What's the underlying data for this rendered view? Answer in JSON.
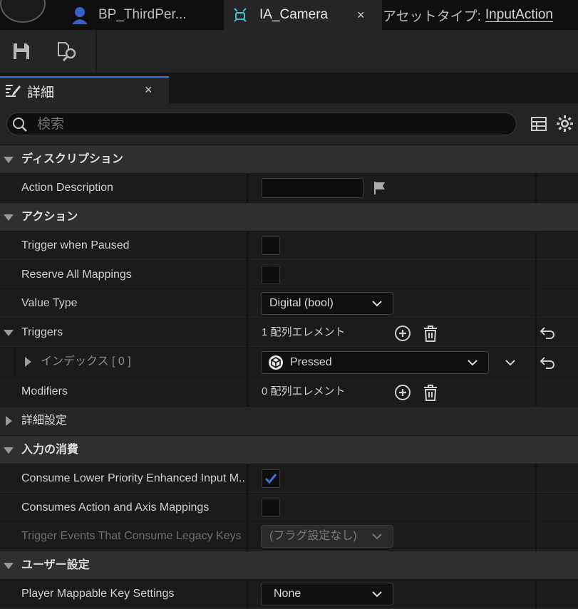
{
  "tabs": [
    {
      "label": "BP_ThirdPer...",
      "icon": "character-icon",
      "active": false
    },
    {
      "label": "IA_Camera",
      "icon": "input-action-icon",
      "active": true,
      "close": "×"
    }
  ],
  "asset_type": {
    "label": "アセットタイプ:",
    "value": "InputAction"
  },
  "toolbar": {
    "save": "save-icon",
    "browse": "browse-asset-icon"
  },
  "details_tab": {
    "label": "詳細",
    "close": "×"
  },
  "search": {
    "placeholder": "検索"
  },
  "sections": {
    "description": {
      "title": "ディスクリプション",
      "action_description": {
        "label": "Action Description",
        "value": ""
      }
    },
    "action": {
      "title": "アクション",
      "trigger_when_paused": {
        "label": "Trigger when Paused",
        "checked": false
      },
      "reserve_all_mappings": {
        "label": "Reserve All Mappings",
        "checked": false
      },
      "value_type": {
        "label": "Value Type",
        "value": "Digital (bool)"
      },
      "triggers": {
        "label": "Triggers",
        "count": "1 配列エレメント"
      },
      "index": {
        "label": "インデックス [ 0 ]",
        "value": "Pressed"
      },
      "modifiers": {
        "label": "Modifiers",
        "count": "0 配列エレメント"
      }
    },
    "advanced": {
      "title": "詳細設定"
    },
    "input_consumption": {
      "title": "入力の消費",
      "consume_lower": {
        "label": "Consume Lower Priority Enhanced Input M...",
        "checked": true
      },
      "consumes_action_axis": {
        "label": "Consumes Action and Axis Mappings",
        "checked": false
      },
      "trigger_events_legacy": {
        "label": "Trigger Events That Consume Legacy Keys",
        "value": "(フラグ設定なし)"
      }
    },
    "user_settings": {
      "title": "ユーザー設定",
      "player_mappable": {
        "label": "Player Mappable Key Settings",
        "value": "None"
      }
    }
  },
  "colors": {
    "accent": "#2f7bd6",
    "panel": "#242424",
    "row": "#1b1b1b",
    "category": "#2f2f2f"
  }
}
